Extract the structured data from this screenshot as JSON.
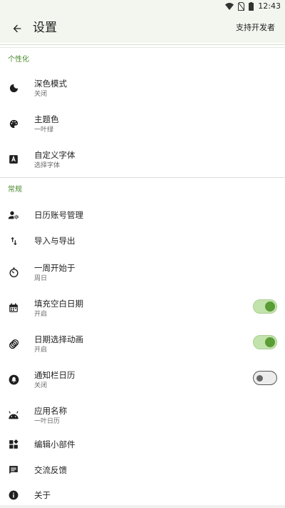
{
  "status_bar": {
    "time": "12:43"
  },
  "app_bar": {
    "title": "设置",
    "support_label": "支持开发者"
  },
  "sections": {
    "personalization": {
      "header": "个性化",
      "items": {
        "dark_mode": {
          "title": "深色模式",
          "subtitle": "关闭",
          "icon": "moon-icon"
        },
        "theme_color": {
          "title": "主题色",
          "subtitle": "一叶绿",
          "icon": "palette-icon"
        },
        "custom_font": {
          "title": "自定义字体",
          "subtitle": "选择字体",
          "icon": "font-icon"
        }
      }
    },
    "general": {
      "header": "常规",
      "items": {
        "calendar_accounts": {
          "title": "日历账号管理",
          "icon": "account-settings-icon"
        },
        "import_export": {
          "title": "导入与导出",
          "icon": "import-export-icon"
        },
        "week_start": {
          "title": "一周开始于",
          "subtitle": "周日",
          "icon": "timer-icon"
        },
        "fill_blank_dates": {
          "title": "填充空白日期",
          "subtitle": "开启",
          "icon": "calendar-icon",
          "toggle": true
        },
        "date_animation": {
          "title": "日期选择动画",
          "subtitle": "开启",
          "icon": "animation-icon",
          "toggle": true
        },
        "notification_calendar": {
          "title": "通知栏日历",
          "subtitle": "关闭",
          "icon": "bell-icon",
          "toggle": false
        },
        "app_name": {
          "title": "应用名称",
          "subtitle": "一叶日历",
          "icon": "android-icon"
        },
        "edit_widgets": {
          "title": "编辑小部件",
          "icon": "widgets-icon"
        },
        "feedback": {
          "title": "交流反馈",
          "icon": "chat-icon"
        },
        "about": {
          "title": "关于",
          "icon": "info-icon"
        }
      }
    }
  },
  "colors": {
    "accent": "#5a9c35",
    "section_header": "#4a8b2c",
    "app_bar_bg": "#f3f6ef",
    "toggle_on_track": "#c3e3ad"
  }
}
